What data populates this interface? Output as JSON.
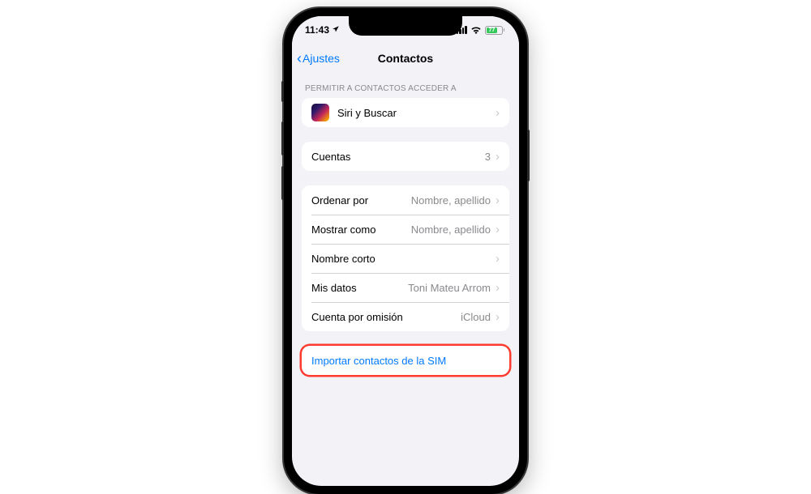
{
  "statusBar": {
    "time": "11:43",
    "batteryPercent": "77"
  },
  "nav": {
    "backLabel": "Ajustes",
    "title": "Contactos"
  },
  "sectionHeader": "PERMITIR A CONTACTOS ACCEDER A",
  "siriRow": {
    "label": "Siri y Buscar"
  },
  "accountsRow": {
    "label": "Cuentas",
    "value": "3"
  },
  "settingsRows": [
    {
      "label": "Ordenar por",
      "value": "Nombre, apellido"
    },
    {
      "label": "Mostrar como",
      "value": "Nombre, apellido"
    },
    {
      "label": "Nombre corto",
      "value": ""
    },
    {
      "label": "Mis datos",
      "value": "Toni Mateu Arrom"
    },
    {
      "label": "Cuenta por omisión",
      "value": "iCloud"
    }
  ],
  "importRow": {
    "label": "Importar contactos de la SIM"
  }
}
